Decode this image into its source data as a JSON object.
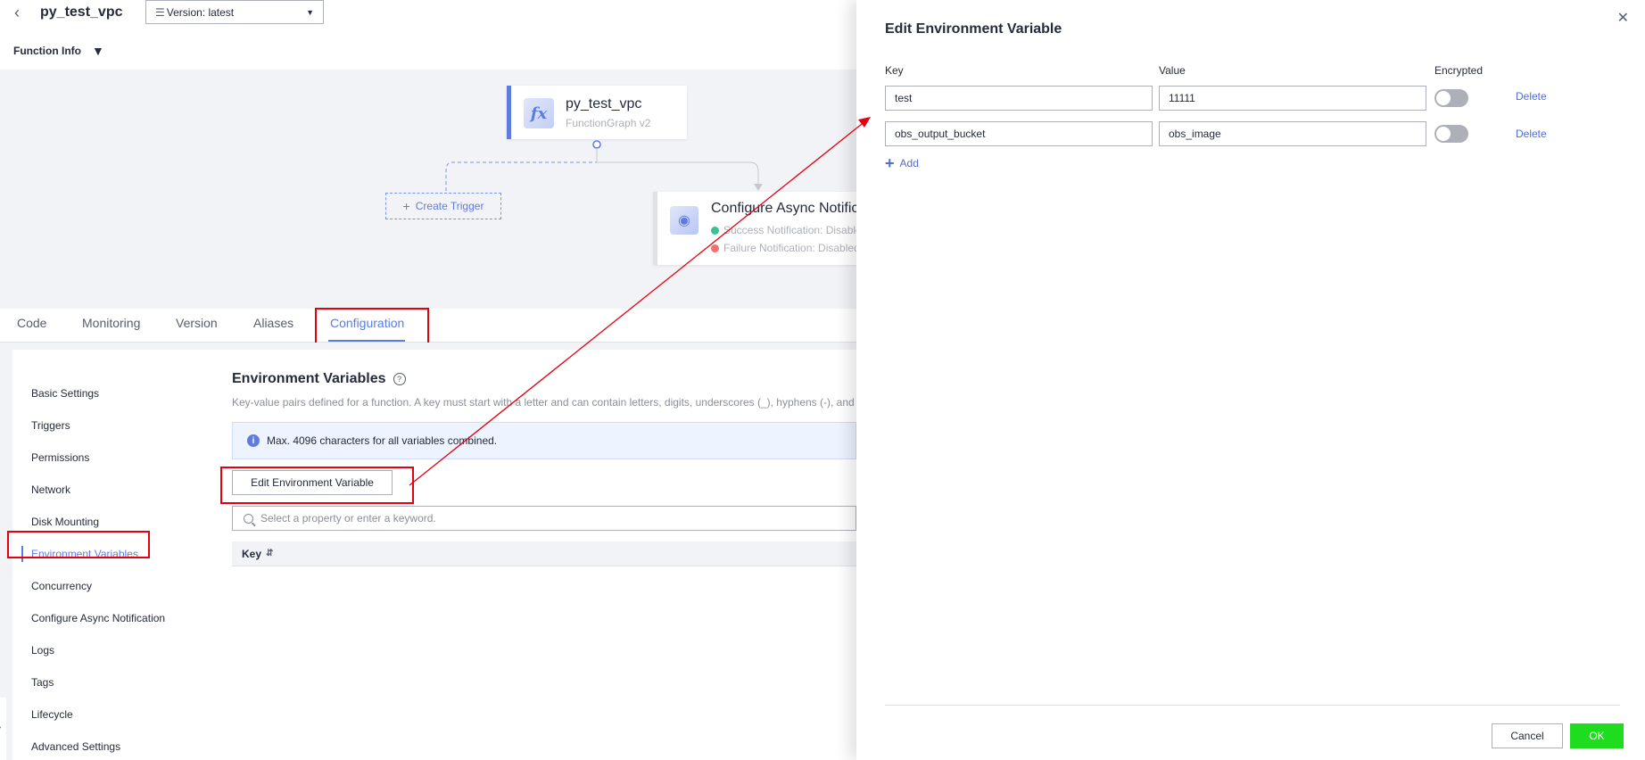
{
  "header": {
    "back_icon": "chevron-left-icon",
    "title": "py_test_vpc",
    "version_label": "Version: latest",
    "function_info_label": "Function Info"
  },
  "diagram": {
    "function_node": {
      "name": "py_test_vpc",
      "subtitle": "FunctionGraph v2",
      "icon": "fx-icon"
    },
    "trigger_button": "Create Trigger",
    "async_node": {
      "name": "Configure Async Notification",
      "success_line": "Success Notification: Disabled",
      "failure_line": "Failure Notification: Disabled",
      "success_color": "#3ac295",
      "failure_color": "#f66f6a"
    }
  },
  "tabs": [
    {
      "label": "Code"
    },
    {
      "label": "Monitoring"
    },
    {
      "label": "Version"
    },
    {
      "label": "Aliases"
    },
    {
      "label": "Configuration"
    }
  ],
  "sidebar": {
    "items": [
      {
        "label": "Basic Settings"
      },
      {
        "label": "Triggers"
      },
      {
        "label": "Permissions"
      },
      {
        "label": "Network"
      },
      {
        "label": "Disk Mounting"
      },
      {
        "label": "Environment Variables"
      },
      {
        "label": "Concurrency"
      },
      {
        "label": "Configure Async Notification"
      },
      {
        "label": "Logs"
      },
      {
        "label": "Tags"
      },
      {
        "label": "Lifecycle"
      },
      {
        "label": "Advanced Settings"
      }
    ],
    "active_index": 5
  },
  "main": {
    "section_title": "Environment Variables",
    "description": "Key-value pairs defined for a function. A key must start with a letter and can contain letters, digits, underscores (_), hyphens (-), and",
    "info_text": "Max. 4096 characters for all variables combined.",
    "edit_button": "Edit Environment Variable",
    "search_placeholder": "Select a property or enter a keyword.",
    "table_header_key": "Key"
  },
  "drawer": {
    "title": "Edit Environment Variable",
    "columns": {
      "key": "Key",
      "value": "Value",
      "encrypted": "Encrypted"
    },
    "rows": [
      {
        "key": "test",
        "value": "11111",
        "encrypted": false,
        "delete_label": "Delete"
      },
      {
        "key": "obs_output_bucket",
        "value": "obs_image",
        "encrypted": false,
        "delete_label": "Delete"
      }
    ],
    "add_label": "Add",
    "cancel_label": "Cancel",
    "ok_label": "OK"
  },
  "colors": {
    "accent": "#5e7ce0",
    "highlight": "#e5000f",
    "ok_button": "#1edc1e"
  }
}
